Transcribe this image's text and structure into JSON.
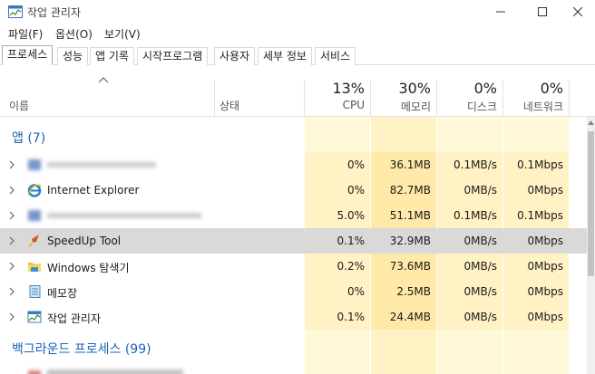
{
  "window": {
    "title": "작업 관리자"
  },
  "menu": [
    "파일(F)",
    "옵션(O)",
    "보기(V)"
  ],
  "tabs": [
    "프로세스",
    "성능",
    "앱 기록",
    "시작프로그램",
    "사용자",
    "세부 정보",
    "서비스"
  ],
  "header": {
    "name": "이름",
    "status": "상태",
    "cpu": {
      "pct": "13%",
      "label": "CPU"
    },
    "memory": {
      "pct": "30%",
      "label": "메모리"
    },
    "disk": {
      "pct": "0%",
      "label": "디스크"
    },
    "network": {
      "pct": "0%",
      "label": "네트워크"
    }
  },
  "groups": {
    "apps": "앱 (7)",
    "background": "백그라운드 프로세스 (99)"
  },
  "rows": [
    {
      "name": "",
      "cpu": "0%",
      "mem": "36.1MB",
      "disk": "0.1MB/s",
      "net": "0.1Mbps",
      "icon": "blurred-app-icon"
    },
    {
      "name": "Internet Explorer",
      "cpu": "0%",
      "mem": "82.7MB",
      "disk": "0MB/s",
      "net": "0Mbps",
      "icon": "internet-explorer-icon"
    },
    {
      "name": "",
      "cpu": "5.0%",
      "mem": "51.1MB",
      "disk": "0.1MB/s",
      "net": "0.1Mbps",
      "icon": "blurred-app-icon"
    },
    {
      "name": "SpeedUp Tool",
      "cpu": "0.1%",
      "mem": "32.9MB",
      "disk": "0MB/s",
      "net": "0Mbps",
      "icon": "rocket-icon"
    },
    {
      "name": "Windows 탐색기",
      "cpu": "0.2%",
      "mem": "73.6MB",
      "disk": "0MB/s",
      "net": "0Mbps",
      "icon": "folder-icon"
    },
    {
      "name": "메모장",
      "cpu": "0%",
      "mem": "2.5MB",
      "disk": "0MB/s",
      "net": "0Mbps",
      "icon": "notepad-icon"
    },
    {
      "name": "작업 관리자",
      "cpu": "0.1%",
      "mem": "24.4MB",
      "disk": "0MB/s",
      "net": "0Mbps",
      "icon": "task-manager-icon"
    }
  ],
  "colors": {
    "accent": "#1c63b5",
    "heat_light": "#fff8d9",
    "heat_dark": "#fff2c4",
    "selected": "#d9d9d9"
  }
}
